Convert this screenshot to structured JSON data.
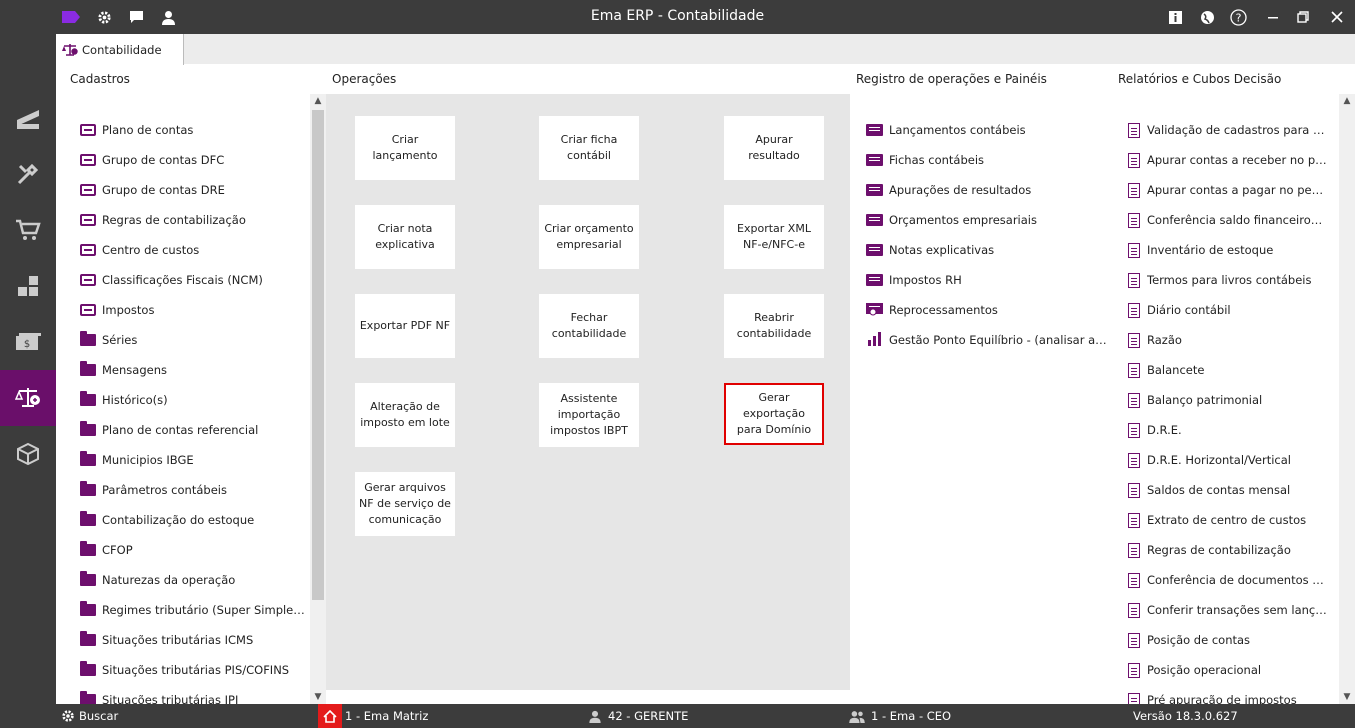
{
  "window": {
    "title": "Ema ERP - Contabilidade"
  },
  "tabs": [
    {
      "label": "Contabilidade"
    }
  ],
  "columns": {
    "cadastros": "Cadastros",
    "operacoes": "Operações",
    "registro": "Registro de operações e Painéis",
    "relatorios": "Relatórios e Cubos Decisão"
  },
  "cadastros": [
    {
      "label": "Plano de contas",
      "icon": "drawer-icon"
    },
    {
      "label": "Grupo de contas DFC",
      "icon": "drawer-icon"
    },
    {
      "label": "Grupo de contas DRE",
      "icon": "drawer-icon"
    },
    {
      "label": "Regras de contabilização",
      "icon": "drawer-icon"
    },
    {
      "label": "Centro de custos",
      "icon": "drawer-icon"
    },
    {
      "label": "Classificações Fiscais (NCM)",
      "icon": "drawer-icon"
    },
    {
      "label": "Impostos",
      "icon": "drawer-icon"
    },
    {
      "label": "Séries",
      "icon": "folder-icon"
    },
    {
      "label": "Mensagens",
      "icon": "folder-icon"
    },
    {
      "label": "Histórico(s)",
      "icon": "folder-icon"
    },
    {
      "label": "Plano de contas referencial",
      "icon": "folder-icon"
    },
    {
      "label": "Municipios IBGE",
      "icon": "folder-icon"
    },
    {
      "label": "Parâmetros contábeis",
      "icon": "folder-icon"
    },
    {
      "label": "Contabilização do estoque",
      "icon": "folder-icon"
    },
    {
      "label": "CFOP",
      "icon": "folder-icon"
    },
    {
      "label": "Naturezas da operação",
      "icon": "folder-icon"
    },
    {
      "label": "Regimes tributário (Super Simple…",
      "icon": "folder-icon"
    },
    {
      "label": "Situações tributárias ICMS",
      "icon": "folder-icon"
    },
    {
      "label": "Situações tributárias PIS/COFINS",
      "icon": "folder-icon"
    },
    {
      "label": "Situações tributárias IPI",
      "icon": "folder-icon"
    }
  ],
  "operacoes": [
    {
      "label": "Criar lançamento"
    },
    {
      "label": "Criar ficha contábil"
    },
    {
      "label": "Apurar resultado"
    },
    {
      "label": "Criar nota explicativa"
    },
    {
      "label": "Criar orçamento empresarial"
    },
    {
      "label": "Exportar XML NF-e/NFC-e"
    },
    {
      "label": "Exportar PDF NF"
    },
    {
      "label": "Fechar contabilidade"
    },
    {
      "label": "Reabrir contabilidade"
    },
    {
      "label": "Alteração de imposto em lote"
    },
    {
      "label": "Assistente importação impostos IBPT"
    },
    {
      "label": "Gerar exportação para Domínio",
      "selected": true
    },
    {
      "label": "Gerar arquivos NF de serviço de comunicação"
    }
  ],
  "registro": [
    {
      "label": "Lançamentos contábeis",
      "icon": "list-icon"
    },
    {
      "label": "Fichas contábeis",
      "icon": "list-icon"
    },
    {
      "label": "Apurações de resultados",
      "icon": "list-icon"
    },
    {
      "label": "Orçamentos empresariais",
      "icon": "list-icon"
    },
    {
      "label": "Notas explicativas",
      "icon": "list-icon"
    },
    {
      "label": "Impostos RH",
      "icon": "list-icon"
    },
    {
      "label": "Reprocessamentos",
      "icon": "reprocess-icon"
    },
    {
      "label": "Gestão Ponto Equilíbrio - (analisar a…",
      "icon": "bar-chart-icon"
    }
  ],
  "relatorios": [
    {
      "label": "Validação de cadastros para si…"
    },
    {
      "label": "Apurar contas a receber no p…"
    },
    {
      "label": "Apurar contas a pagar no perí…"
    },
    {
      "label": "Conferência saldo financeiro…"
    },
    {
      "label": "Inventário de estoque"
    },
    {
      "label": "Termos para livros contábeis"
    },
    {
      "label": "Diário contábil"
    },
    {
      "label": "Razão"
    },
    {
      "label": "Balancete"
    },
    {
      "label": "Balanço patrimonial"
    },
    {
      "label": "D.R.E."
    },
    {
      "label": "D.R.E. Horizontal/Vertical"
    },
    {
      "label": "Saldos de contas mensal"
    },
    {
      "label": "Extrato de centro de custos"
    },
    {
      "label": "Regras de contabilização"
    },
    {
      "label": "Conferência de documentos c…"
    },
    {
      "label": "Conferir transações sem lanç…"
    },
    {
      "label": "Posição de contas"
    },
    {
      "label": "Posição operacional"
    },
    {
      "label": "Pré apuração de impostos"
    }
  ],
  "statusbar": {
    "search": "Buscar",
    "company": "1 - Ema Matriz",
    "user": "42 - GERENTE",
    "role": "1 - Ema - CEO",
    "version": "Versão 18.3.0.627"
  },
  "colors": {
    "accent": "#6d0f6d",
    "active_nav": "#6a0f6a",
    "chrome": "#3c3c3c",
    "selected_border": "#e00000"
  }
}
